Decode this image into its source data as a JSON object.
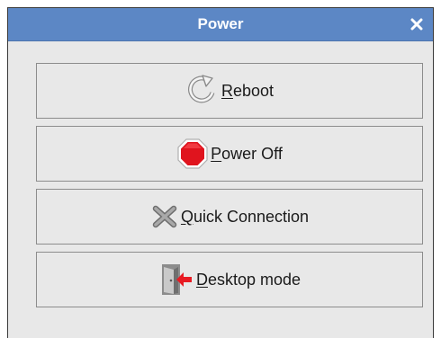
{
  "window": {
    "title": "Power",
    "close_glyph": "×"
  },
  "buttons": [
    {
      "name": "reboot",
      "icon": "reboot-icon",
      "accel": "R",
      "rest": "eboot"
    },
    {
      "name": "power-off",
      "icon": "stop-sign-icon",
      "accel": "P",
      "rest": "ower Off"
    },
    {
      "name": "quick-connection",
      "icon": "x-mark-icon",
      "accel": "Q",
      "rest": "uick Connection"
    },
    {
      "name": "desktop-mode",
      "icon": "door-exit-icon",
      "accel": "D",
      "rest": "esktop mode"
    }
  ],
  "colors": {
    "titlebar": "#5c87c5",
    "background": "#e8e8e8",
    "stop_red": "#e0141e",
    "arrow_red": "#e81b23"
  }
}
